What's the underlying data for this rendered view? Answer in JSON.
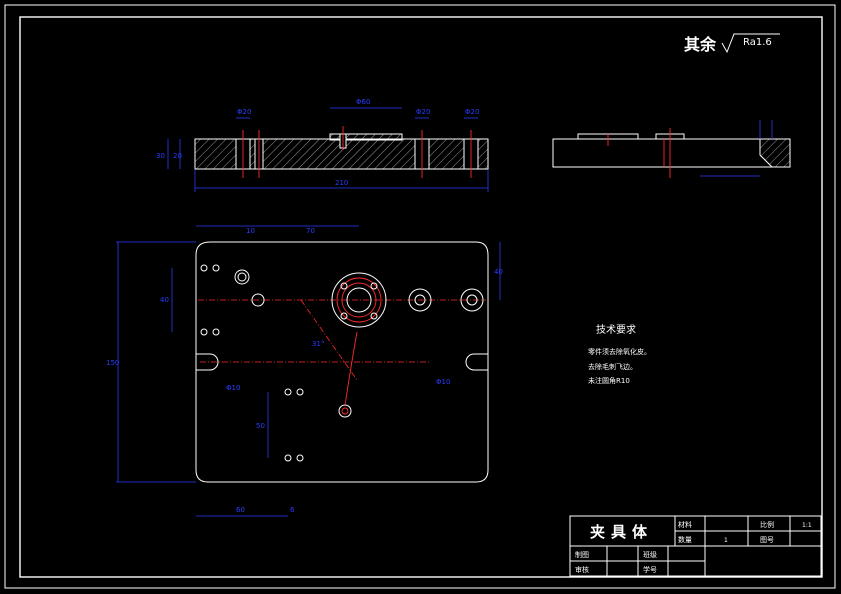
{
  "roughness": {
    "prefix": "其余",
    "value": "Ra1.6"
  },
  "dimensions": {
    "top_d1": "Φ20",
    "top_d2": "Φ60",
    "top_d3": "Φ20",
    "top_d4": "Φ20",
    "top_len": "210",
    "top_h1": "30",
    "top_h2": "20",
    "plan_width": "10",
    "plan_x1": "70",
    "plan_y1": "40",
    "plan_h": "150",
    "plan_v1": "40",
    "plan_v2": "50",
    "plan_bottom": "60",
    "plan_bottom2": "6",
    "angle": "31°",
    "slot_l": "Φ10",
    "slot_r": "Φ10"
  },
  "notes": {
    "heading": "技术要求",
    "line1": "零件须去除氧化皮。",
    "line2": "去除毛刺飞边。",
    "line3": "未注圆角R10"
  },
  "title_block": {
    "part_name": "夹具体",
    "material_label": "材料",
    "scale_label": "比例",
    "scale_value": "1:1",
    "quantity_label": "数量",
    "quantity_value": "1",
    "drawing_no_label": "图号",
    "drawn_label": "制图",
    "checked_label": "审核",
    "class_label": "班级",
    "student_no_label": "学号"
  }
}
